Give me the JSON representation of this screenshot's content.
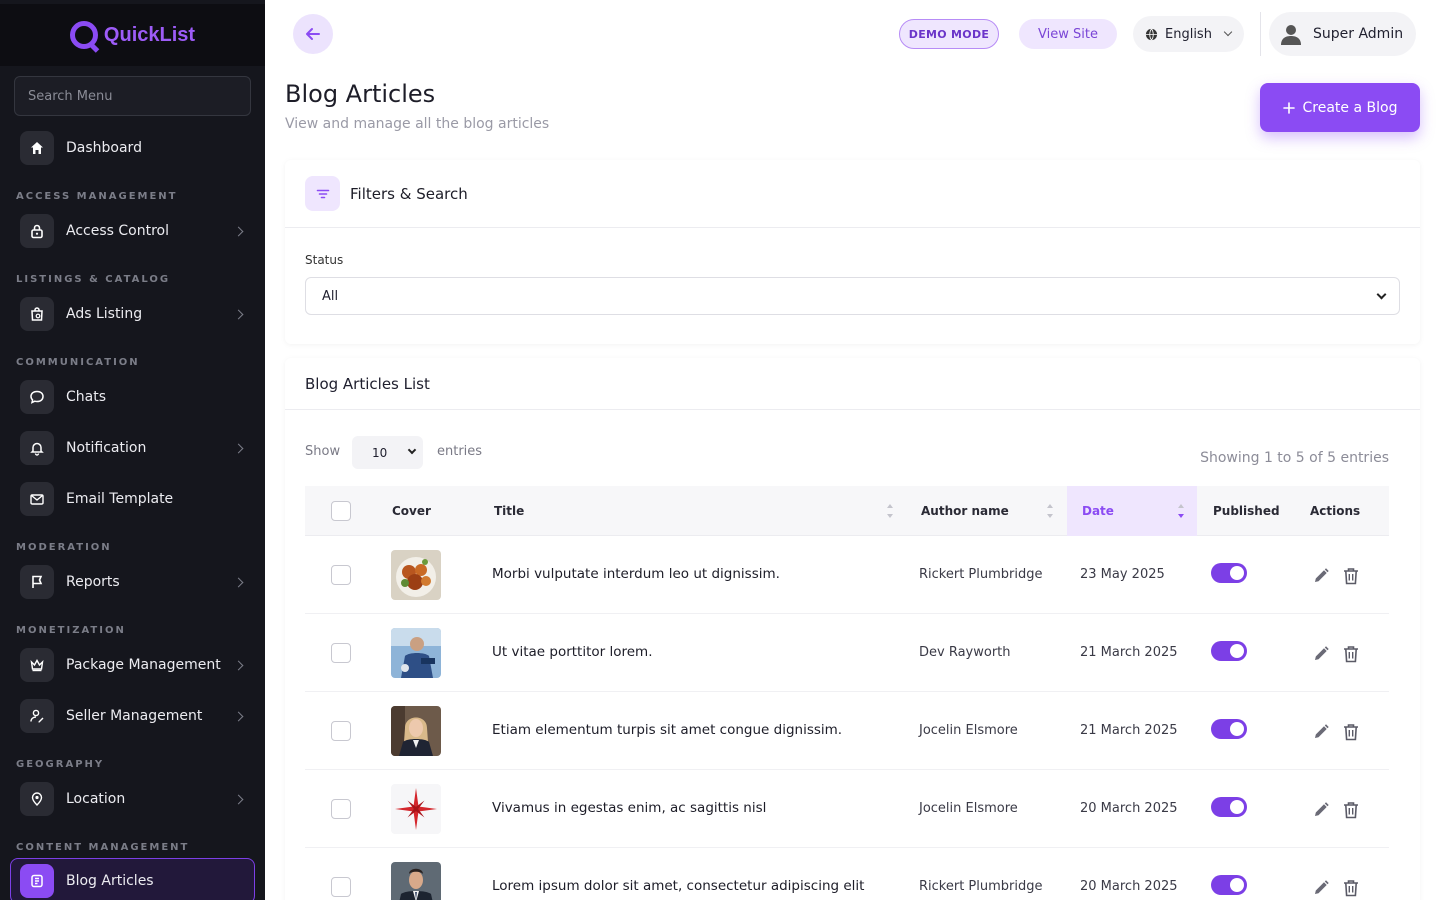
{
  "brand": {
    "name": "QuickList"
  },
  "sidebar": {
    "search_placeholder": "Search Menu",
    "items": [
      {
        "section": "",
        "label": "Dashboard",
        "icon": "home-icon",
        "has_submenu": false
      },
      {
        "section": "ACCESS MANAGEMENT",
        "label": "Access Control",
        "icon": "lock-icon",
        "has_submenu": true
      },
      {
        "section": "LISTINGS & CATALOG",
        "label": "Ads Listing",
        "icon": "shopping-bag-icon",
        "has_submenu": true
      },
      {
        "section": "COMMUNICATION",
        "label": "Chats",
        "icon": "chat-bubble-icon",
        "has_submenu": false
      },
      {
        "section": "",
        "label": "Notification",
        "icon": "bell-icon",
        "has_submenu": true
      },
      {
        "section": "",
        "label": "Email Template",
        "icon": "mail-check-icon",
        "has_submenu": false
      },
      {
        "section": "MODERATION",
        "label": "Reports",
        "icon": "flag-icon",
        "has_submenu": true
      },
      {
        "section": "MONETIZATION",
        "label": "Package Management",
        "icon": "crown-icon",
        "has_submenu": true
      },
      {
        "section": "",
        "label": "Seller Management",
        "icon": "user-edit-icon",
        "has_submenu": true
      },
      {
        "section": "GEOGRAPHY",
        "label": "Location",
        "icon": "map-pin-icon",
        "has_submenu": true
      },
      {
        "section": "CONTENT MANAGEMENT",
        "label": "Blog Articles",
        "icon": "blog-icon",
        "has_submenu": false,
        "active": true
      }
    ]
  },
  "header": {
    "demo_badge": "DEMO MODE",
    "view_site": "View Site",
    "language": "English",
    "user_name": "Super Admin"
  },
  "page": {
    "title": "Blog Articles",
    "subtitle": "View and manage all the blog articles",
    "create_button": "Create a Blog"
  },
  "filters": {
    "title": "Filters & Search",
    "status_label": "Status",
    "status_value": "All"
  },
  "list": {
    "title": "Blog Articles List",
    "show_label": "Show",
    "entries_value": "10",
    "entries_label": "entries",
    "showing_text": "Showing 1 to 5 of 5 entries",
    "columns": [
      "Cover",
      "Title",
      "Author name",
      "Date",
      "Published",
      "Actions"
    ],
    "sorted_column": "Date",
    "rows": [
      {
        "title": "Morbi vulputate interdum leo ut dignissim.",
        "author": "Rickert Plumbridge",
        "date": "23 May 2025",
        "published": true,
        "cover": "food-photo"
      },
      {
        "title": "Ut vitae porttitor lorem.",
        "author": "Dev Rayworth",
        "date": "21 March 2025",
        "published": true,
        "cover": "worker-photo"
      },
      {
        "title": "Etiam elementum turpis sit amet congue dignissim.",
        "author": "Jocelin Elsmore",
        "date": "21 March 2025",
        "published": true,
        "cover": "woman-portrait-photo"
      },
      {
        "title": "Vivamus in egestas enim, ac sagittis nisl",
        "author": "Jocelin Elsmore",
        "date": "20 March 2025",
        "published": true,
        "cover": "compass-star-logo"
      },
      {
        "title": "Lorem ipsum dolor sit amet, consectetur adipiscing elit",
        "author": "Rickert Plumbridge",
        "date": "20 March 2025",
        "published": true,
        "cover": "man-suit-photo"
      }
    ]
  },
  "colors": {
    "accent": "#8b4bf3",
    "sidebar_bg": "#15161d",
    "accent_soft": "#efe6fe"
  }
}
